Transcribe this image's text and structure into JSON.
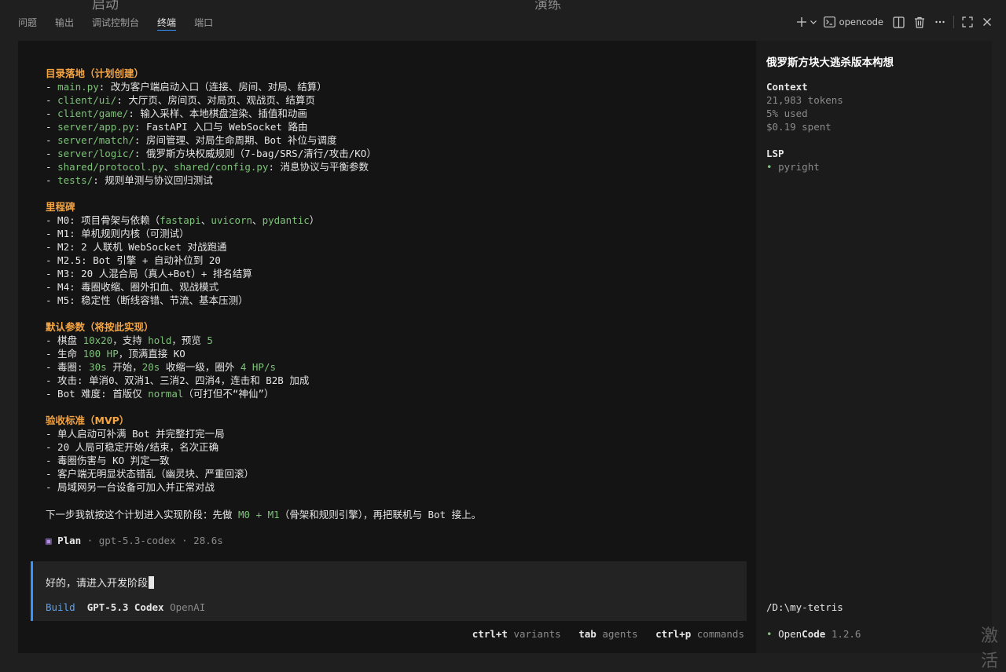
{
  "top_ghost": {
    "left": "启动",
    "right": "演练"
  },
  "tabs": [
    {
      "label": "问题",
      "active": false
    },
    {
      "label": "输出",
      "active": false
    },
    {
      "label": "调试控制台",
      "active": false
    },
    {
      "label": "终端",
      "active": true
    },
    {
      "label": "端口",
      "active": false
    }
  ],
  "toolbar": {
    "terminal_name": "opencode"
  },
  "output": {
    "sec1": {
      "heading": "目录落地（计划创建）",
      "items": [
        {
          "path": "main.py",
          "desc": ": 改为客户端启动入口（连接、房间、对局、结算）"
        },
        {
          "path": "client/ui/",
          "desc": ": 大厅页、房间页、对局页、观战页、结算页"
        },
        {
          "path": "client/game/",
          "desc": ": 输入采样、本地棋盘渲染、插值和动画"
        },
        {
          "path": "server/app.py",
          "desc": ": FastAPI 入口与 WebSocket 路由"
        },
        {
          "path": "server/match/",
          "desc": ": 房间管理、对局生命周期、Bot 补位与调度"
        },
        {
          "path": "server/logic/",
          "desc": ": 俄罗斯方块权威规则（7-bag/SRS/清行/攻击/KO）"
        },
        {
          "path": "shared/protocol.py",
          "sep": "、",
          "path2": "shared/config.py",
          "desc": ": 消息协议与平衡参数"
        },
        {
          "path": "tests/",
          "desc": ": 规则单测与协议回归测试"
        }
      ]
    },
    "sec2": {
      "heading": "里程碑",
      "m0": {
        "pre": "- M0: 项目骨架与依赖（",
        "a": "fastapi",
        "s1": "、",
        "b": "uvicorn",
        "s2": "、",
        "c": "pydantic",
        "post": "）"
      },
      "lines": [
        "- M1: 单机规则内核（可测试）",
        "- M2: 2 人联机 WebSocket 对战跑通",
        "- M2.5: Bot 引擎 + 自动补位到 20",
        "- M3: 20 人混合局（真人+Bot）+ 排名结算",
        "- M4: 毒圈收缩、圈外扣血、观战模式",
        "- M5: 稳定性（断线容错、节流、基本压测）"
      ]
    },
    "sec3": {
      "heading": "默认参数（将按此实现）",
      "l1": {
        "a": "- 棋盘 ",
        "b": "10x20",
        "c": "，支持 ",
        "d": "hold",
        "e": "，预览 ",
        "f": "5"
      },
      "l2": {
        "a": "- 生命 ",
        "b": "100 HP",
        "c": "，顶满直接 KO"
      },
      "l3": {
        "a": "- 毒圈: ",
        "b": "30s",
        "c": " 开始，",
        "d": "20s",
        "e": " 收缩一级，圈外 ",
        "f": "4 HP/s"
      },
      "l4": "- 攻击: 单消0、双消1、三消2、四消4，连击和 B2B 加成",
      "l5": {
        "a": "- Bot 难度: 首版仅 ",
        "b": "normal",
        "c": "（可打但不“神仙”）"
      }
    },
    "sec4": {
      "heading": "验收标准（MVP）",
      "lines": [
        "- 单人启动可补满 Bot 并完整打完一局",
        "- 20 人局可稳定开始/结束，名次正确",
        "- 毒圈伤害与 KO 判定一致",
        "- 客户端无明显状态错乱（幽灵块、严重回滚）",
        "- 局域网另一台设备可加入并正常对战"
      ]
    },
    "next": {
      "a": "下一步我就按这个计划进入实现阶段：先做 ",
      "b": "M0 + M1",
      "c": "（骨架和规则引擎），再把联机与 Bot 接上。"
    },
    "plan": {
      "label": "Plan",
      "model": "gpt-5.3-codex",
      "time": "28.6s"
    }
  },
  "input": {
    "text": "好的，请进入开发阶段",
    "mode": "Build",
    "model": "GPT-5.3 Codex",
    "provider": "OpenAI"
  },
  "hints": [
    {
      "key": "ctrl+t",
      "label": "variants"
    },
    {
      "key": "tab",
      "label": "agents"
    },
    {
      "key": "ctrl+p",
      "label": "commands"
    }
  ],
  "side": {
    "title": "俄罗斯方块大逃杀版本构想",
    "context_label": "Context",
    "tokens": "21,983 tokens",
    "used": "5% used",
    "spent": "$0.19 spent",
    "lsp_label": "LSP",
    "lsp_item": "pyright",
    "cwd": "/D:\\my-tetris",
    "app_a": "Open",
    "app_b": "Code",
    "version": "1.2.6"
  },
  "watermark": "激活"
}
